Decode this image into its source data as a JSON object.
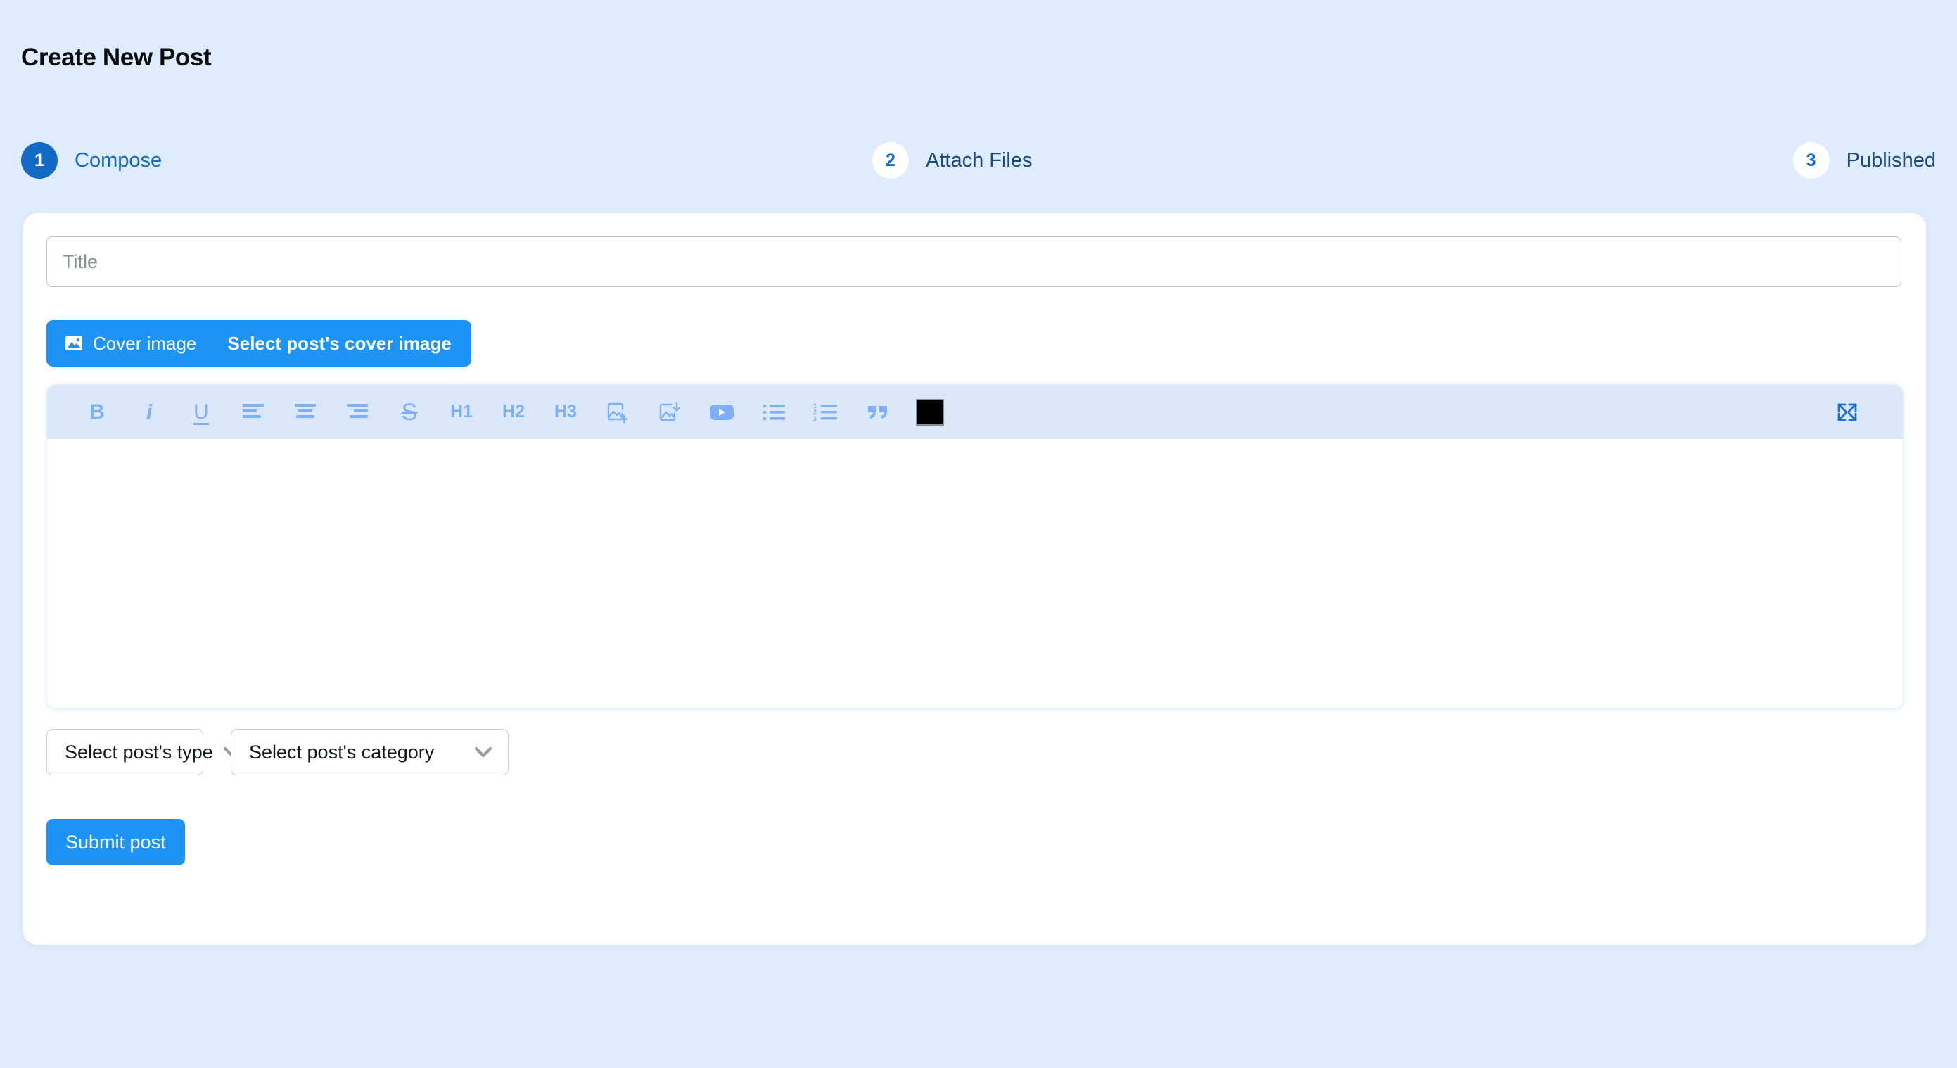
{
  "page": {
    "title": "Create New Post",
    "background_color": "#dfecfd"
  },
  "stepper": {
    "steps": [
      {
        "number": "1",
        "label": "Compose",
        "state": "active"
      },
      {
        "number": "2",
        "label": "Attach Files",
        "state": "idle"
      },
      {
        "number": "3",
        "label": "Published",
        "state": "idle"
      }
    ],
    "active_color": "#1369c4"
  },
  "form": {
    "title_field": {
      "value": "",
      "placeholder": "Title"
    },
    "cover_image_button": {
      "icon": "image-icon",
      "label": "Cover image",
      "value": "Select post's cover image",
      "color": "#1d94f5"
    },
    "editor": {
      "content": "",
      "toolbar": [
        {
          "name": "bold",
          "glyph": "B",
          "kind": "text"
        },
        {
          "name": "italic",
          "glyph": "i",
          "kind": "text"
        },
        {
          "name": "underline",
          "glyph": "U",
          "kind": "text"
        },
        {
          "name": "align-left",
          "glyph": "",
          "kind": "icon"
        },
        {
          "name": "align-center",
          "glyph": "",
          "kind": "icon"
        },
        {
          "name": "align-right",
          "glyph": "",
          "kind": "icon"
        },
        {
          "name": "strikethrough",
          "glyph": "S",
          "kind": "text"
        },
        {
          "name": "heading-1",
          "glyph": "H1",
          "kind": "text"
        },
        {
          "name": "heading-2",
          "glyph": "H2",
          "kind": "text"
        },
        {
          "name": "heading-3",
          "glyph": "H3",
          "kind": "text"
        },
        {
          "name": "add-image",
          "glyph": "",
          "kind": "icon"
        },
        {
          "name": "upload-image",
          "glyph": "",
          "kind": "icon"
        },
        {
          "name": "insert-video",
          "glyph": "",
          "kind": "icon"
        },
        {
          "name": "bullet-list",
          "glyph": "",
          "kind": "icon"
        },
        {
          "name": "numbered-list",
          "glyph": "",
          "kind": "icon"
        },
        {
          "name": "blockquote",
          "glyph": "",
          "kind": "icon"
        },
        {
          "name": "text-color",
          "glyph": "",
          "kind": "swatch"
        },
        {
          "name": "fullscreen",
          "glyph": "",
          "kind": "icon"
        }
      ],
      "toolbar_background": "#dbe8fb",
      "icon_color": "#7db0f7",
      "text_color_swatch": "#000000"
    },
    "post_type_select": {
      "value": "Select post's type"
    },
    "post_category_select": {
      "value": "Select post's category"
    },
    "submit_button": {
      "label": "Submit post"
    }
  }
}
